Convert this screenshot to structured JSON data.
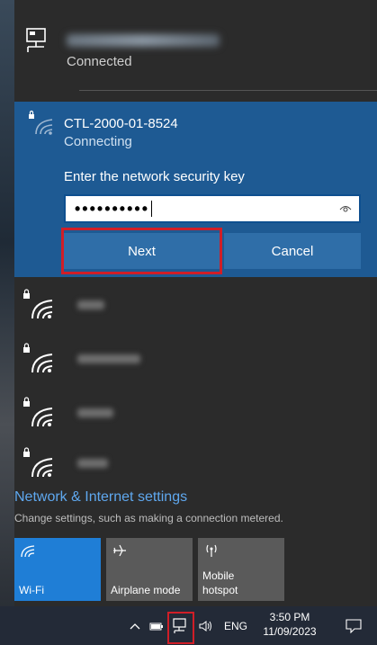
{
  "ethernet": {
    "status": "Connected",
    "icon": "ethernet-icon"
  },
  "active_network": {
    "ssid": "CTL-2000-01-8524",
    "status": "Connecting",
    "key_label": "Enter the network security key",
    "password_value": "••••••••••",
    "icon": "wifi-secured-icon"
  },
  "buttons": {
    "next": "Next",
    "cancel": "Cancel"
  },
  "other_networks_count_visible": 4,
  "settings": {
    "link": "Network & Internet settings",
    "description": "Change settings, such as making a connection metered."
  },
  "quick_actions": [
    {
      "label": "Wi-Fi",
      "icon": "wifi-icon",
      "active": true
    },
    {
      "label": "Airplane mode",
      "icon": "airplane-icon",
      "active": false
    },
    {
      "label_line1": "Mobile",
      "label_line2": "hotspot",
      "icon": "hotspot-icon",
      "active": false
    }
  ],
  "taskbar": {
    "language": "ENG",
    "time": "3:50 PM",
    "date": "11/09/2023"
  },
  "colors": {
    "flyout_bg": "#2b2b2b",
    "accent": "#1e5a93",
    "button": "#2f6ea8",
    "highlight": "#d01e27",
    "link": "#5fa8ef",
    "tile_active": "#1f7ed6"
  }
}
